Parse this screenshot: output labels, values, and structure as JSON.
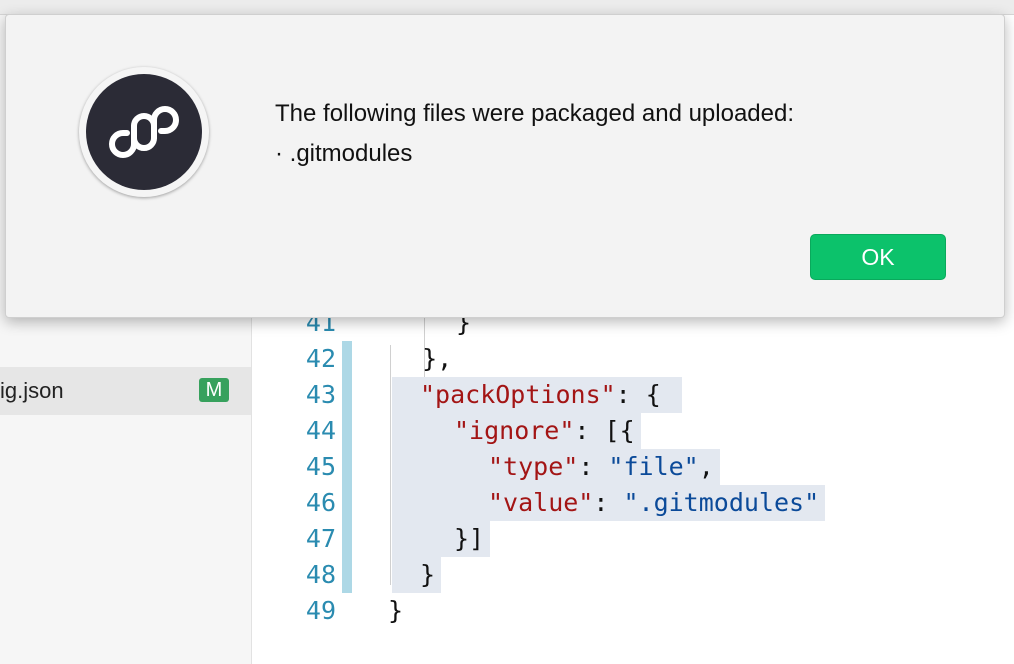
{
  "sidebar": {
    "file": {
      "name": "ig.json",
      "status_badge": "M"
    }
  },
  "editor": {
    "partial_line_number": "41",
    "lines": [
      {
        "num": "42",
        "text": "  },"
      },
      {
        "num": "43",
        "key": "\"packOptions\"",
        "rest": ": {"
      },
      {
        "num": "44",
        "key": "\"ignore\"",
        "rest": ": [{"
      },
      {
        "num": "45",
        "key": "\"type\"",
        "sep": ": ",
        "val": "\"file\"",
        "tail": ","
      },
      {
        "num": "46",
        "key": "\"value\"",
        "sep": ": ",
        "val": "\".gitmodules\"",
        "tail": ""
      },
      {
        "num": "47",
        "text": "}]"
      },
      {
        "num": "48",
        "text": "}"
      },
      {
        "num": "49",
        "text": "}"
      }
    ],
    "partial_brace": "}"
  },
  "dialog": {
    "message": "The following files were packaged and uploaded:",
    "detail": "· .gitmodules",
    "ok_label": "OK",
    "icon": "mini-program-link-icon"
  },
  "colors": {
    "accent_green": "#0cc26b",
    "badge_green": "#37a15d",
    "line_number": "#2a8bb0",
    "json_key": "#a31515",
    "json_string": "#0b4a99",
    "selection": "#e3e8f0",
    "gutter_mark": "#add8e6"
  }
}
